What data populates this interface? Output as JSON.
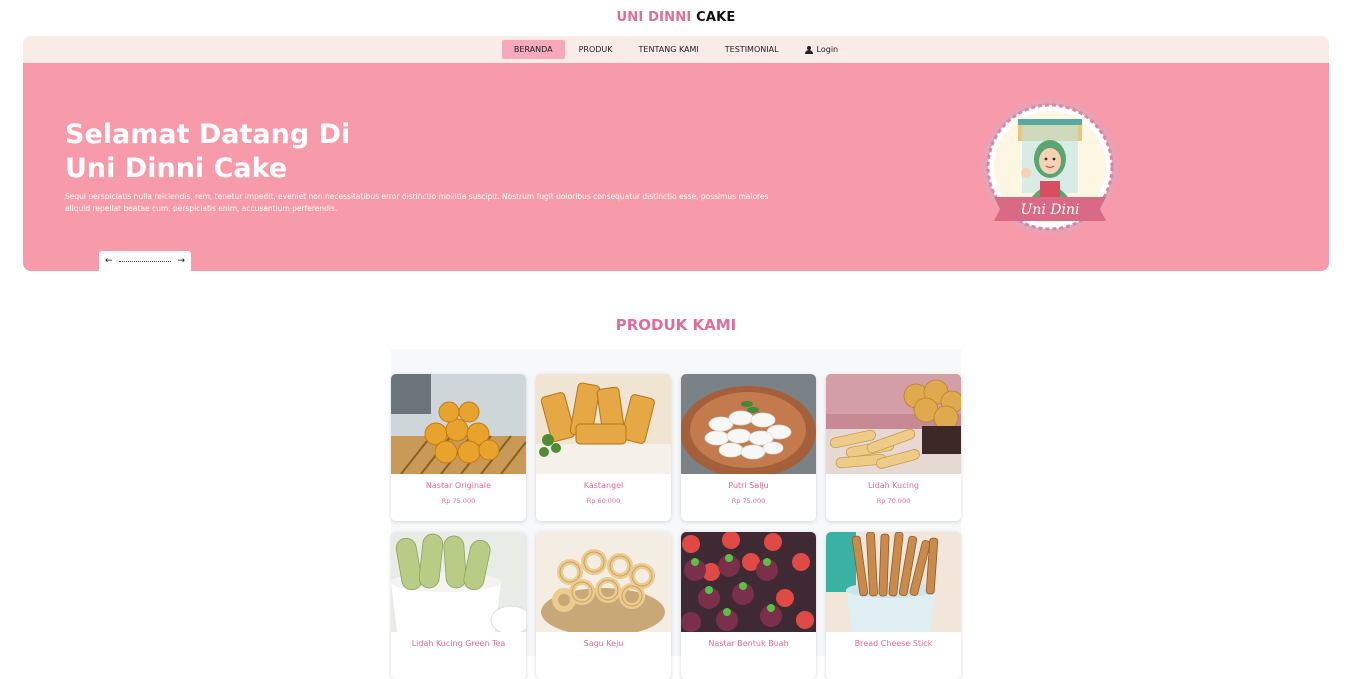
{
  "brand": {
    "part1": "UNI DINNI",
    "part2": "CAKE"
  },
  "nav": {
    "items": [
      "BERANDA",
      "PRODUK",
      "TENTANG KAMI",
      "TESTIMONIAL"
    ],
    "login": "Login",
    "active": "BERANDA"
  },
  "hero": {
    "title_line1": "Selamat Datang Di",
    "title_line2": "Uni Dinni Cake",
    "text": "Sequi perspiciatis nulla reiciendis, rem, tenetur impedit, eveniet non necessitatibus error distinctio mollitia suscipit. Nostrum fugit doloribus consequatur distinctio esse, possimus maiores aliquid repellat beatae cum, perspiciatis enim, accusantium perferendis.",
    "prev": "←",
    "next": "→",
    "logo_text": "Uni Dini"
  },
  "products": {
    "title": "PRODUK KAMI",
    "items": [
      {
        "name": "Nastar Originale",
        "price": "Rp 75.000"
      },
      {
        "name": "Kastangel",
        "price": "Rp 60.000"
      },
      {
        "name": "Putri Salju",
        "price": "Rp 75.000"
      },
      {
        "name": "Lidah Kucing",
        "price": "Rp 70.000"
      },
      {
        "name": "Lidah Kucing Green Tea",
        "price": ""
      },
      {
        "name": "Sagu Keju",
        "price": ""
      },
      {
        "name": "Nastar Bentuk Buah",
        "price": ""
      },
      {
        "name": "Bread Cheese Stick",
        "price": ""
      }
    ]
  },
  "colors": {
    "accent": "#e06c9a",
    "hero": "#f79aa9",
    "nav": "#f9ebe6"
  }
}
